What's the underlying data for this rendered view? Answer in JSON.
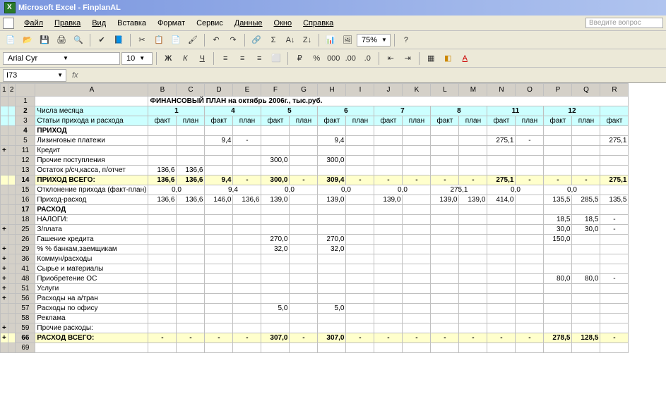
{
  "app": {
    "title": "Microsoft Excel - FinplanAL"
  },
  "menu": {
    "items": [
      "Файл",
      "Правка",
      "Вид",
      "Вставка",
      "Формат",
      "Сервис",
      "Данные",
      "Окно",
      "Справка"
    ],
    "ask_placeholder": "Введите вопрос"
  },
  "toolbar": {
    "zoom": "75%"
  },
  "format": {
    "font": "Arial Cyr",
    "size": "10"
  },
  "namebox": {
    "ref": "I73",
    "fx": "fx"
  },
  "columns": [
    "A",
    "B",
    "C",
    "D",
    "E",
    "F",
    "G",
    "H",
    "I",
    "J",
    "K",
    "L",
    "M",
    "N",
    "O",
    "P",
    "Q",
    "R"
  ],
  "outline_levels": [
    "1",
    "2"
  ],
  "chart_data": {
    "type": "table",
    "title": "ФИНАНСОВЫЙ  ПЛАН  на  октябрь  2006г., тыс.руб.",
    "day_numbers": [
      "1",
      "4",
      "5",
      "6",
      "7",
      "8",
      "11",
      "12",
      ""
    ],
    "sub_headers": [
      "факт",
      "план",
      "факт",
      "план",
      "факт",
      "план",
      "факт",
      "план",
      "факт",
      "план",
      "факт",
      "план",
      "факт",
      "план",
      "факт",
      "план",
      "факт"
    ],
    "row_labels": {
      "r2": "Числа  месяца",
      "r3": "Статьи прихода и расхода",
      "r4": "ПРИХОД",
      "r5": "Лизинговые платежи",
      "r11": "Кредит",
      "r12": "Прочие поступления",
      "r13": "Остаток р/сч,касса, п/отчет",
      "r14": "ПРИХОД ВСЕГО:",
      "r15": "Отклонение прихода  (факт-план)",
      "r16": "Приход-расход",
      "r17": "РАСХОД",
      "r18": "НАЛОГИ:",
      "r25": "З/плата",
      "r26": "Гашение кредита",
      "r29": "% % банкам,заемщикам",
      "r36": "Коммун/расходы",
      "r41": "Сырье и материалы",
      "r48": "Приобретение ОС",
      "r51": "Услуги",
      "r56": "Расходы на а/тран",
      "r57": "Расходы по офису",
      "r58": "Реклама",
      "r59": "Прочие расходы:",
      "r66": "РАСХОД ВСЕГО:"
    },
    "rows": {
      "r5": [
        "",
        "",
        "9,4",
        "-",
        "",
        "",
        "9,4",
        "",
        "",
        "",
        "",
        "",
        "275,1",
        "-",
        "",
        "",
        "275,1",
        "-",
        ""
      ],
      "r12": [
        "",
        "",
        "",
        "",
        "300,0",
        "",
        "300,0",
        "",
        "",
        "",
        "",
        "",
        "",
        "",
        "",
        "",
        "",
        "",
        ""
      ],
      "r13": [
        "136,6",
        "136,6",
        "",
        "",
        "",
        "",
        "",
        "",
        "",
        "",
        "",
        "",
        "",
        "",
        "",
        "",
        "",
        "",
        ""
      ],
      "r14": [
        "136,6",
        "136,6",
        "9,4",
        "-",
        "300,0",
        "-",
        "309,4",
        "-",
        "-",
        "-",
        "-",
        "-",
        "275,1",
        "-",
        "-",
        "-",
        "275,1",
        "-",
        ""
      ],
      "r15": [
        "0,0",
        "",
        "9,4",
        "",
        "0,0",
        "",
        "0,0",
        "",
        "0,0",
        "",
        "275,1",
        "",
        "0,0",
        "",
        "0,0",
        "",
        ""
      ],
      "r16": [
        "136,6",
        "136,6",
        "146,0",
        "136,6",
        "139,0",
        "",
        "139,0",
        "",
        "139,0",
        "",
        "139,0",
        "139,0",
        "414,0",
        "",
        "135,5",
        "285,5",
        "135,5",
        "",
        "135,5"
      ],
      "r18": [
        "",
        "",
        "",
        "",
        "",
        "",
        "",
        "",
        "",
        "",
        "",
        "",
        "",
        "",
        "18,5",
        "18,5",
        "-",
        "",
        ""
      ],
      "r25": [
        "",
        "",
        "",
        "",
        "",
        "",
        "",
        "",
        "",
        "",
        "",
        "",
        "",
        "",
        "30,0",
        "30,0",
        "-",
        "",
        ""
      ],
      "r26": [
        "",
        "",
        "",
        "",
        "270,0",
        "",
        "270,0",
        "",
        "",
        "",
        "",
        "",
        "",
        "",
        "150,0",
        "",
        "",
        "",
        ""
      ],
      "r29": [
        "",
        "",
        "",
        "",
        "32,0",
        "",
        "32,0",
        "",
        "",
        "",
        "",
        "",
        "",
        "",
        "",
        "",
        "",
        "",
        ""
      ],
      "r48": [
        "",
        "",
        "",
        "",
        "",
        "",
        "",
        "",
        "",
        "",
        "",
        "",
        "",
        "",
        "80,0",
        "80,0",
        "-",
        "",
        ""
      ],
      "r57": [
        "",
        "",
        "",
        "",
        "5,0",
        "",
        "5,0",
        "",
        "",
        "",
        "",
        "",
        "",
        "",
        "",
        "",
        "",
        "",
        ""
      ],
      "r66": [
        "-",
        "-",
        "-",
        "-",
        "307,0",
        "-",
        "307,0",
        "-",
        "-",
        "-",
        "-",
        "-",
        "-",
        "-",
        "278,5",
        "128,5",
        "-",
        "-",
        "-"
      ]
    }
  }
}
